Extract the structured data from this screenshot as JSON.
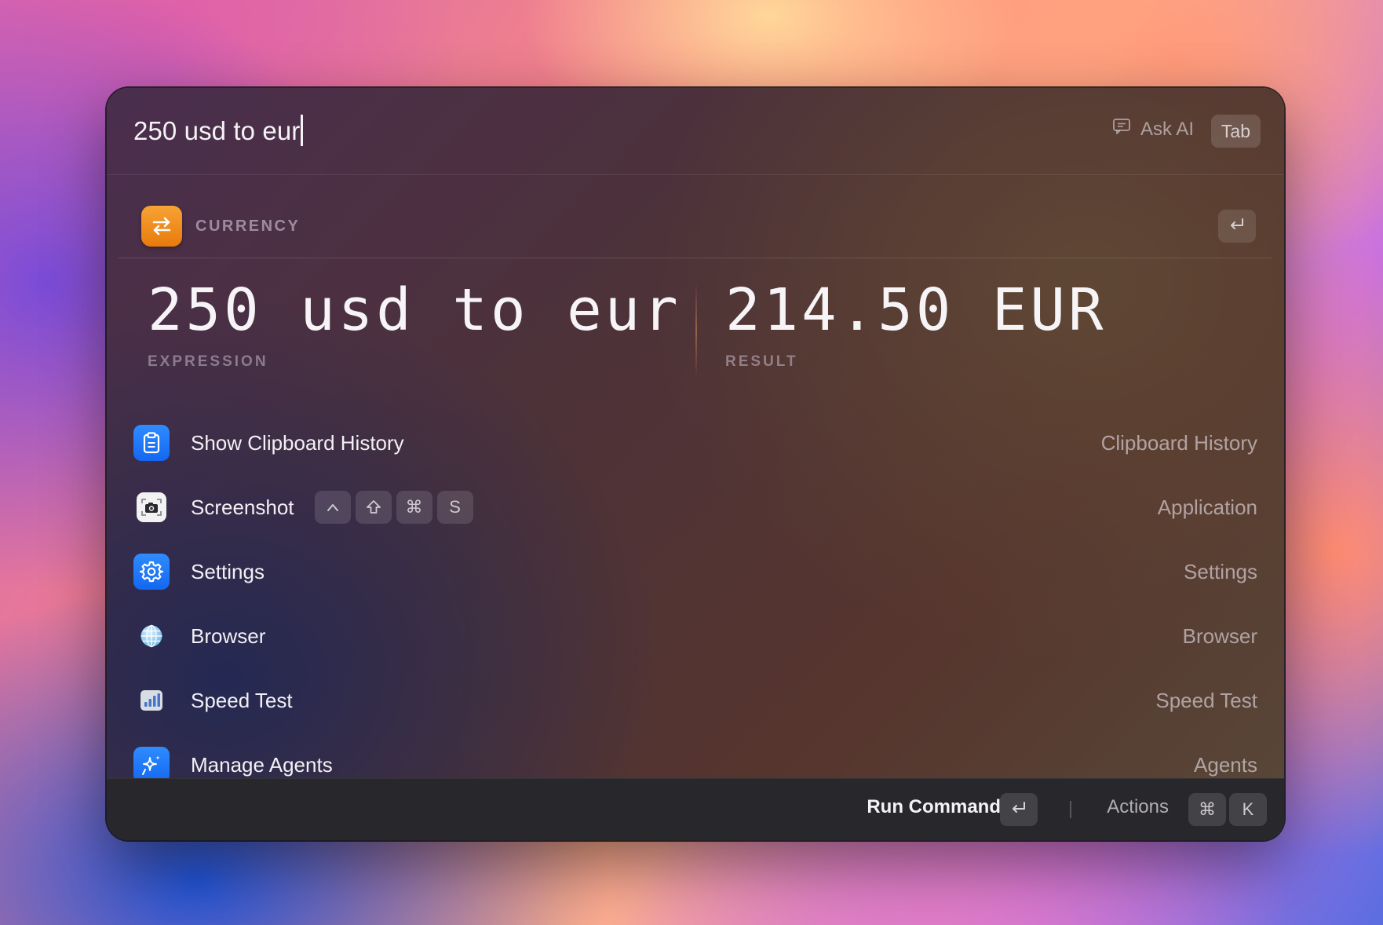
{
  "search": {
    "query": "250 usd to eur",
    "ask_ai_label": "Ask AI",
    "tab_key": "Tab"
  },
  "currency": {
    "section_label": "CURRENCY",
    "icon": "arrows-swap-icon",
    "expression": "250 usd to eur",
    "expression_label": "EXPRESSION",
    "result": "214.50 EUR",
    "result_label": "RESULT",
    "accent_color": "#ef8a1c"
  },
  "commands": [
    {
      "title": "Show Clipboard History",
      "subtitle": "Clipboard History",
      "icon": "clipboard-icon"
    },
    {
      "title": "Screenshot",
      "subtitle": "Application",
      "icon": "camera-icon",
      "shortcut": [
        "^",
        "⇧",
        "⌘",
        "S"
      ]
    },
    {
      "title": "Settings",
      "subtitle": "Settings",
      "icon": "gear-icon"
    },
    {
      "title": "Browser",
      "subtitle": "Browser",
      "icon": "globe-icon"
    },
    {
      "title": "Speed Test",
      "subtitle": "Speed Test",
      "icon": "bar-chart-icon"
    },
    {
      "title": "Manage Agents",
      "subtitle": "Agents",
      "icon": "sparkles-icon"
    }
  ],
  "footer": {
    "run_command": "Run Command",
    "actions": "Actions",
    "actions_keys": [
      "⌘",
      "K"
    ]
  }
}
